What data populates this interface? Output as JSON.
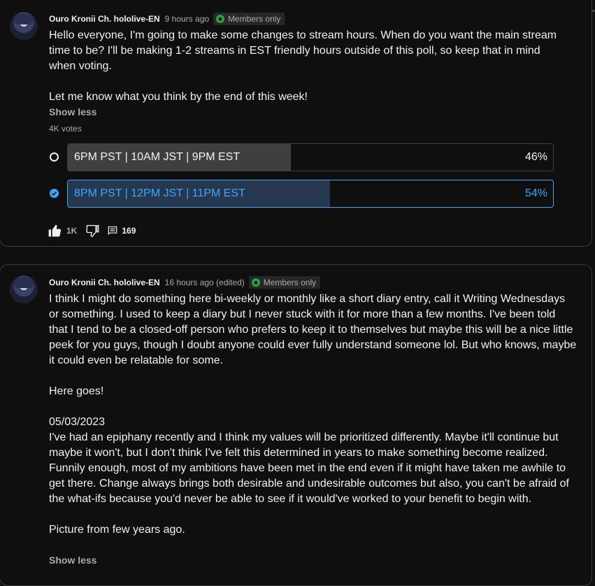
{
  "posts": [
    {
      "author": "Ouro Kronii Ch. hololive-EN",
      "time": "9 hours ago",
      "badge": "Members only",
      "body": "Hello everyone, I'm going to make some changes to stream hours. When do you want the main stream time to be? I'll be making 1-2 streams in EST friendly hours outside of this poll, so keep that in mind when voting.\n\nLet me know what you think by the end of this week!",
      "show_less": "Show less",
      "votes": "4K votes",
      "poll": [
        {
          "label": "6PM PST | 10AM JST | 9PM EST",
          "percent_text": "46%",
          "percent": 46,
          "selected": false
        },
        {
          "label": "8PM PST | 12PM JST | 11PM EST",
          "percent_text": "54%",
          "percent": 54,
          "selected": true
        }
      ],
      "likes": "1K",
      "comments": "169"
    },
    {
      "author": "Ouro Kronii Ch. hololive-EN",
      "time": "16 hours ago (edited)",
      "badge": "Members only",
      "body": "I think I might do something here bi-weekly or monthly like a short diary entry, call it Writing Wednesdays or something. I used to keep a diary but I never stuck with it for more than a few months. I've been told that I tend to be a closed-off person who prefers to keep it to themselves but maybe this will be a nice little peek for you guys, though I doubt anyone could ever fully understand someone lol. But who knows, maybe it could even be relatable for some.\n\nHere goes!\n\n05/03/2023\nI've had an epiphany recently and I think my values will be prioritized differently. Maybe it'll continue but maybe it won't, but I don't think I've felt this determined in years to make something become realized. Funnily enough, most of my ambitions have been met in the end even if it might have taken me awhile to get there. Change always brings both desirable and undesirable outcomes but also, you can't be afraid of the what-ifs because you'd never be able to see if it would've worked to your benefit to begin with.\n\nPicture from few years ago.",
      "show_less": "Show less"
    }
  ],
  "colors": {
    "accent": "#3ea6ff",
    "member_badge": "#2ba640",
    "background": "#0f0f0f"
  },
  "icons": [
    "avatar",
    "member-star-icon",
    "radio-empty-icon",
    "radio-checked-icon",
    "thumbs-up-icon",
    "thumbs-down-icon",
    "comment-icon"
  ]
}
